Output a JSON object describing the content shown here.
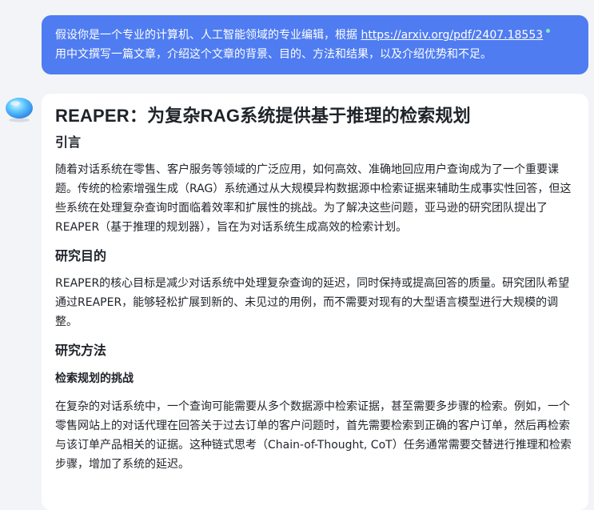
{
  "user_message": {
    "text_before": "假设你是一个专业的计算机、人工智能领域的专业编辑，根据 ",
    "link_text": "https://arxiv.org/pdf/2407.18553",
    "text_after": "用中文撰写一篇文章，介绍这个文章的背景、目的、方法和结果，以及介绍优势和不足。"
  },
  "answer": {
    "title": "REAPER：为复杂RAG系统提供基于推理的检索规划",
    "sections": [
      {
        "heading": "引言",
        "paragraph": "随着对话系统在零售、客户服务等领域的广泛应用，如何高效、准确地回应用户查询成为了一个重要课题。传统的检索增强生成（RAG）系统通过从大规模异构数据源中检索证据来辅助生成事实性回答，但这些系统在处理复杂查询时面临着效率和扩展性的挑战。为了解决这些问题，亚马逊的研究团队提出了REAPER（基于推理的规划器），旨在为对话系统生成高效的检索计划。"
      },
      {
        "heading": "研究目的",
        "paragraph": "REAPER的核心目标是减少对话系统中处理复杂查询的延迟，同时保持或提高回答的质量。研究团队希望通过REAPER，能够轻松扩展到新的、未见过的用例，而不需要对现有的大型语言模型进行大规模的调整。"
      },
      {
        "heading": "研究方法",
        "subheading": "检索规划的挑战",
        "paragraph": "在复杂的对话系统中，一个查询可能需要从多个数据源中检索证据，甚至需要多步骤的检索。例如，一个零售网站上的对话代理在回答关于过去订单的客户问题时，首先需要检索到正确的客户订单，然后再检索与该订单产品相关的证据。这种链式思考（Chain-of-Thought, CoT）任务通常需要交替进行推理和检索步骤，增加了系统的延迟。"
      }
    ]
  },
  "icons": {
    "avatar": "assistant-orb-icon"
  },
  "colors": {
    "accent": "#4f7cf0",
    "background": "#f3f4f7",
    "card": "#ffffff",
    "text": "#1f2329",
    "link_dot": "#7ee8c4"
  }
}
